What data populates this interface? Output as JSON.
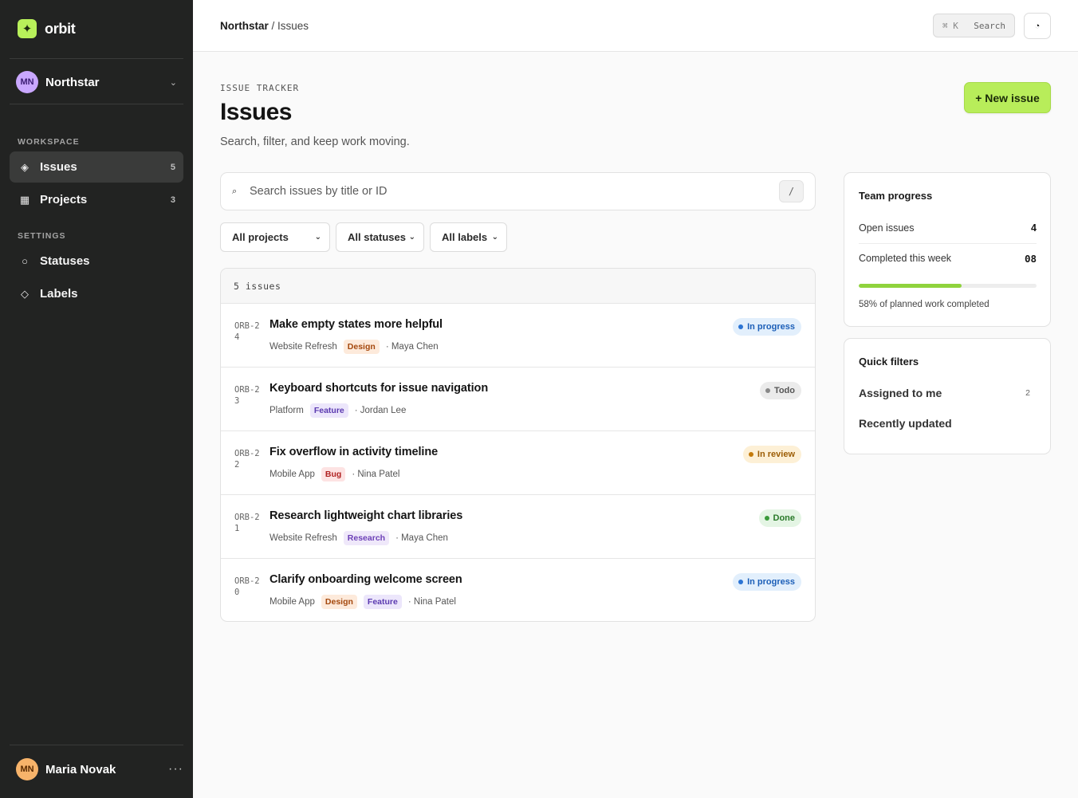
{
  "brand": {
    "name": "orbit",
    "mark": "✦"
  },
  "workspace": {
    "initials": "MN",
    "name": "Northstar",
    "chevron": "⌄"
  },
  "sidebar": {
    "sections": {
      "workspace": "WORKSPACE",
      "settings": "SETTINGS"
    },
    "items": [
      {
        "label": "Issues",
        "count": "5",
        "icon": "◈",
        "icon_name": "issues-icon"
      },
      {
        "label": "Projects",
        "count": "3",
        "icon": "▦",
        "icon_name": "projects-icon"
      },
      {
        "label": "Statuses",
        "icon": "○",
        "icon_name": "statuses-icon"
      },
      {
        "label": "Labels",
        "icon": "◇",
        "icon_name": "labels-icon"
      }
    ]
  },
  "user": {
    "initials": "MN",
    "name": "Maria Novak",
    "more": "···"
  },
  "topbar": {
    "breadcrumb_workspace": "Northstar",
    "breadcrumb_sep": " / ",
    "breadcrumb_page": "Issues",
    "search_shortcut": "⌘ K",
    "search_label": "Search",
    "theme_icon": "◔"
  },
  "header": {
    "eyebrow": "ISSUE TRACKER",
    "title": "Issues",
    "subtitle": "Search, filter, and keep work moving.",
    "new_button": "+ New issue"
  },
  "search": {
    "placeholder": "Search issues by title or ID",
    "icon": "⌕",
    "shortcut": "/"
  },
  "filters": [
    {
      "label": "All projects",
      "caret": "⌄"
    },
    {
      "label": "All statuses",
      "caret": "⌄"
    },
    {
      "label": "All labels",
      "caret": "⌄"
    }
  ],
  "list": {
    "count_label": "5 issues",
    "rows": [
      {
        "id": "ORB-24",
        "title": "Make empty states more helpful",
        "project": "Website Refresh",
        "tags": [
          {
            "label": "Design",
            "kind": "design"
          }
        ],
        "assignee": "· Maya Chen",
        "status": "In progress",
        "status_kind": "progress"
      },
      {
        "id": "ORB-23",
        "title": "Keyboard shortcuts for issue navigation",
        "project": "Platform",
        "tags": [
          {
            "label": "Feature",
            "kind": "feature"
          }
        ],
        "assignee": "· Jordan Lee",
        "status": "Todo",
        "status_kind": "todo"
      },
      {
        "id": "ORB-22",
        "title": "Fix overflow in activity timeline",
        "project": "Mobile App",
        "tags": [
          {
            "label": "Bug",
            "kind": "bug"
          }
        ],
        "assignee": "· Nina Patel",
        "status": "In review",
        "status_kind": "review"
      },
      {
        "id": "ORB-21",
        "title": "Research lightweight chart libraries",
        "project": "Website Refresh",
        "tags": [
          {
            "label": "Research",
            "kind": "research"
          }
        ],
        "assignee": "· Maya Chen",
        "status": "Done",
        "status_kind": "done"
      },
      {
        "id": "ORB-20",
        "title": "Clarify onboarding welcome screen",
        "project": "Mobile App",
        "tags": [
          {
            "label": "Design",
            "kind": "design"
          },
          {
            "label": "Feature",
            "kind": "feature"
          }
        ],
        "assignee": "· Nina Patel",
        "status": "In progress",
        "status_kind": "progress"
      }
    ]
  },
  "progress_card": {
    "title": "Team progress",
    "open_label": "Open issues",
    "open_value": "4",
    "completed_label": "Completed this week",
    "completed_value": "08",
    "percent": 58,
    "caption": "58% of planned work completed"
  },
  "quick_filters": {
    "title": "Quick filters",
    "items": [
      {
        "label": "Assigned to me",
        "count": "2"
      },
      {
        "label": "Recently updated",
        "count": ""
      }
    ]
  },
  "colors": {
    "accent": "#b8ed5a",
    "sidebar_bg": "#222322",
    "progress_fill": "#8fd33d"
  }
}
